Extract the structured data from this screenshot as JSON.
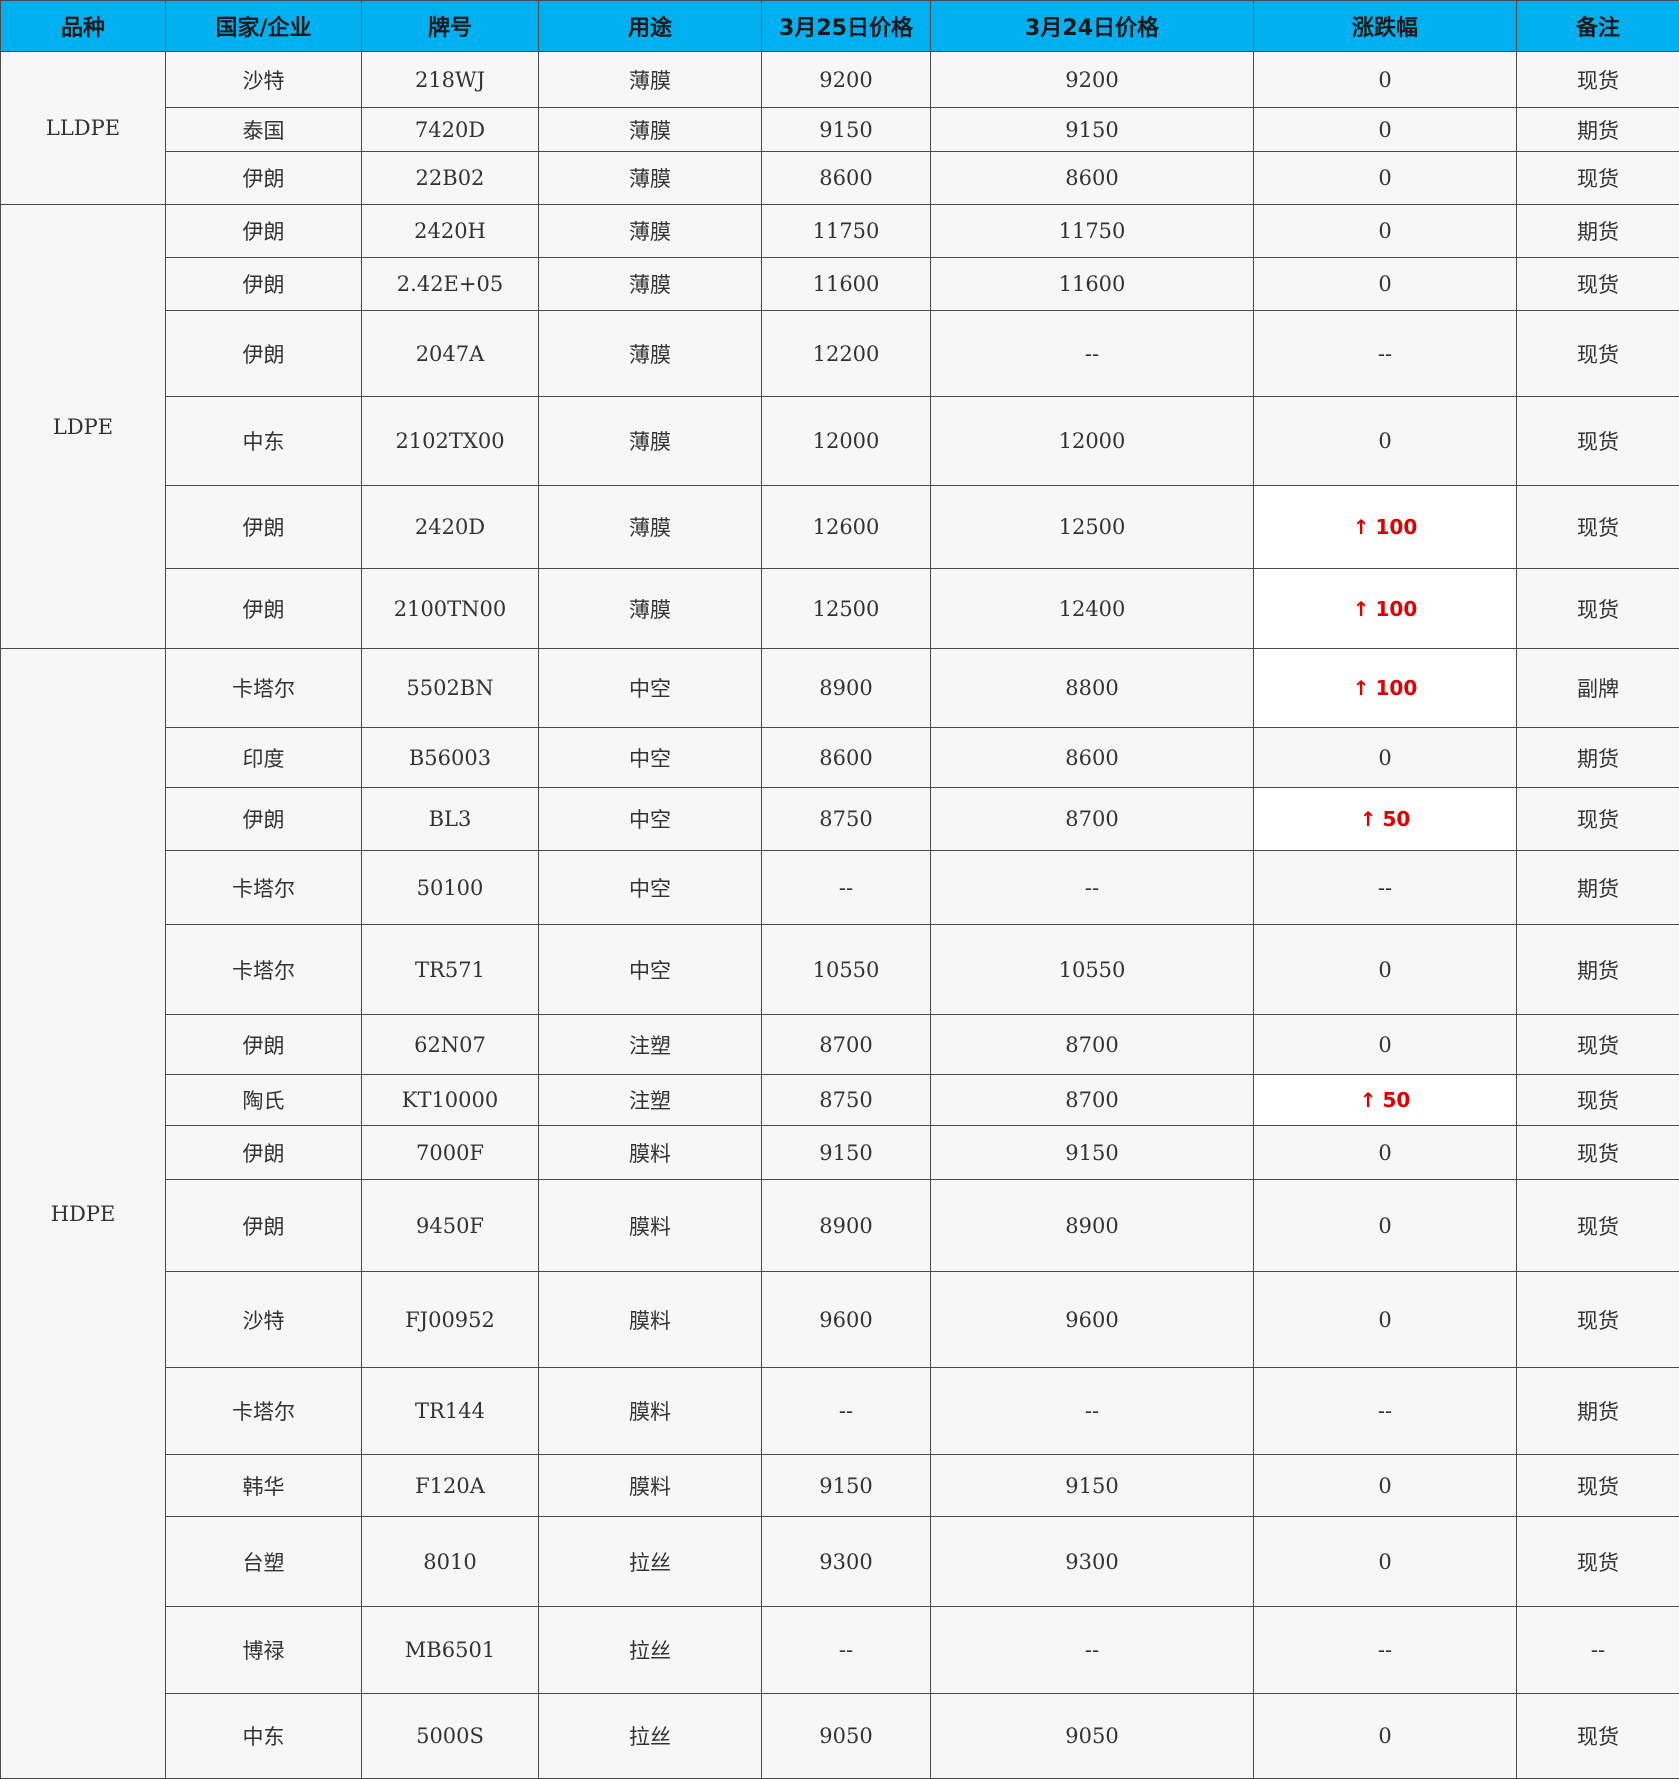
{
  "headers": [
    "品种",
    "国家/企业",
    "牌号",
    "用途",
    "3月25日价格",
    "3月24日价格",
    "涨跌幅",
    "备注"
  ],
  "arrow_up_symbol": "↑",
  "change_up_color": "#e00000",
  "header_color": "#00b0f0",
  "categories": [
    {
      "name": "LLDPE",
      "rows": [
        {
          "company": "沙特",
          "grade": "218WJ",
          "usage": "薄膜",
          "price_0325": "9200",
          "price_0324": "9200",
          "change": "0",
          "up": false,
          "note": "现货"
        },
        {
          "company": "泰国",
          "grade": "7420D",
          "usage": "薄膜",
          "price_0325": "9150",
          "price_0324": "9150",
          "change": "0",
          "up": false,
          "note": "期货"
        },
        {
          "company": "伊朗",
          "grade": "22B02",
          "usage": "薄膜",
          "price_0325": "8600",
          "price_0324": "8600",
          "change": "0",
          "up": false,
          "note": "现货"
        }
      ]
    },
    {
      "name": "LDPE",
      "rows": [
        {
          "company": "伊朗",
          "grade": "2420H",
          "usage": "薄膜",
          "price_0325": "11750",
          "price_0324": "11750",
          "change": "0",
          "up": false,
          "note": "期货"
        },
        {
          "company": "伊朗",
          "grade": "2.42E+05",
          "usage": "薄膜",
          "price_0325": "11600",
          "price_0324": "11600",
          "change": "0",
          "up": false,
          "note": "现货"
        },
        {
          "company": "伊朗",
          "grade": "2047A",
          "usage": "薄膜",
          "price_0325": "12200",
          "price_0324": "--",
          "change": "--",
          "up": false,
          "note": "现货"
        },
        {
          "company": "中东",
          "grade": "2102TX00",
          "usage": "薄膜",
          "price_0325": "12000",
          "price_0324": "12000",
          "change": "0",
          "up": false,
          "note": "现货"
        },
        {
          "company": "伊朗",
          "grade": "2420D",
          "usage": "薄膜",
          "price_0325": "12600",
          "price_0324": "12500",
          "change": "100",
          "up": true,
          "note": "现货"
        },
        {
          "company": "伊朗",
          "grade": "2100TN00",
          "usage": "薄膜",
          "price_0325": "12500",
          "price_0324": "12400",
          "change": "100",
          "up": true,
          "note": "现货"
        }
      ]
    },
    {
      "name": "HDPE",
      "rows": [
        {
          "company": "卡塔尔",
          "grade": "5502BN",
          "usage": "中空",
          "price_0325": "8900",
          "price_0324": "8800",
          "change": "100",
          "up": true,
          "note": "副牌"
        },
        {
          "company": "印度",
          "grade": "B56003",
          "usage": "中空",
          "price_0325": "8600",
          "price_0324": "8600",
          "change": "0",
          "up": false,
          "note": "期货"
        },
        {
          "company": "伊朗",
          "grade": "BL3",
          "usage": "中空",
          "price_0325": "8750",
          "price_0324": "8700",
          "change": "50",
          "up": true,
          "note": "现货"
        },
        {
          "company": "卡塔尔",
          "grade": "50100",
          "usage": "中空",
          "price_0325": "--",
          "price_0324": "--",
          "change": "--",
          "up": false,
          "note": "期货"
        },
        {
          "company": "卡塔尔",
          "grade": "TR571",
          "usage": "中空",
          "price_0325": "10550",
          "price_0324": "10550",
          "change": "0",
          "up": false,
          "note": "期货"
        },
        {
          "company": "伊朗",
          "grade": "62N07",
          "usage": "注塑",
          "price_0325": "8700",
          "price_0324": "8700",
          "change": "0",
          "up": false,
          "note": "现货"
        },
        {
          "company": "陶氏",
          "grade": "KT10000",
          "usage": "注塑",
          "price_0325": "8750",
          "price_0324": "8700",
          "change": "50",
          "up": true,
          "note": "现货"
        },
        {
          "company": "伊朗",
          "grade": "7000F",
          "usage": "膜料",
          "price_0325": "9150",
          "price_0324": "9150",
          "change": "0",
          "up": false,
          "note": "现货"
        },
        {
          "company": "伊朗",
          "grade": "9450F",
          "usage": "膜料",
          "price_0325": "8900",
          "price_0324": "8900",
          "change": "0",
          "up": false,
          "note": "现货"
        },
        {
          "company": "沙特",
          "grade": "FJ00952",
          "usage": "膜料",
          "price_0325": "9600",
          "price_0324": "9600",
          "change": "0",
          "up": false,
          "note": "现货"
        },
        {
          "company": "卡塔尔",
          "grade": "TR144",
          "usage": "膜料",
          "price_0325": "--",
          "price_0324": "--",
          "change": "--",
          "up": false,
          "note": "期货"
        },
        {
          "company": "韩华",
          "grade": "F120A",
          "usage": "膜料",
          "price_0325": "9150",
          "price_0324": "9150",
          "change": "0",
          "up": false,
          "note": "现货"
        },
        {
          "company": "台塑",
          "grade": "8010",
          "usage": "拉丝",
          "price_0325": "9300",
          "price_0324": "9300",
          "change": "0",
          "up": false,
          "note": "现货"
        },
        {
          "company": "博禄",
          "grade": "MB6501",
          "usage": "拉丝",
          "price_0325": "--",
          "price_0324": "--",
          "change": "--",
          "up": false,
          "note": "--"
        },
        {
          "company": "中东",
          "grade": "5000S",
          "usage": "拉丝",
          "price_0325": "9050",
          "price_0324": "9050",
          "change": "0",
          "up": false,
          "note": "现货"
        }
      ]
    }
  ]
}
